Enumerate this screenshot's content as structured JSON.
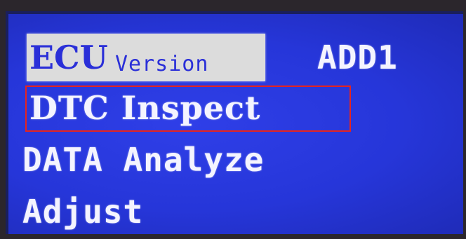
{
  "screen": {
    "background_color": "#2636d9",
    "text_color": "#f4f4ff",
    "highlight_bg": "#dcdcdc",
    "highlight_text_color": "#2a2fd8",
    "selection_border_color": "#e5241f"
  },
  "menu": {
    "ecu_label": "ECU",
    "version_label": "Version",
    "add_label": "ADD1",
    "dtc_label": "DTC Inspect",
    "data_label": "DATA Analyze",
    "adjust_label": "Adjust"
  }
}
